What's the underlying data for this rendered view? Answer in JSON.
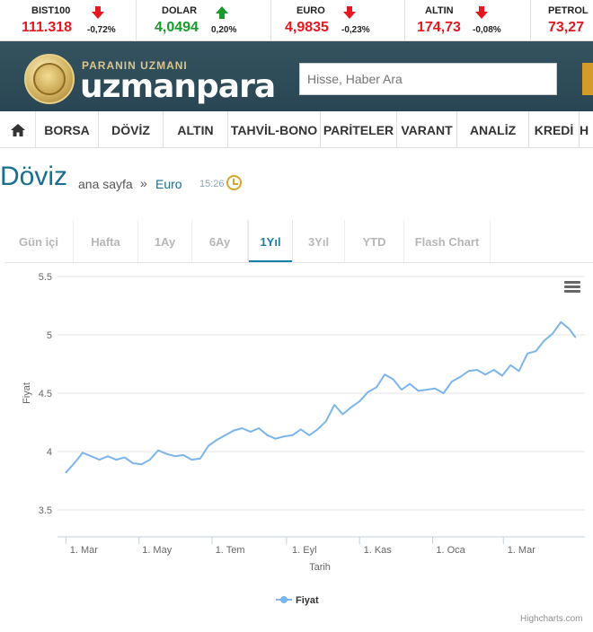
{
  "ticker": [
    {
      "name": "BIST100",
      "value": "111.318",
      "change": "-0,72%",
      "direction": "down"
    },
    {
      "name": "DOLAR",
      "value": "4,0494",
      "change": "0,20%",
      "direction": "up"
    },
    {
      "name": "EURO",
      "value": "4,9835",
      "change": "-0,23%",
      "direction": "down"
    },
    {
      "name": "ALTIN",
      "value": "174,73",
      "change": "-0,08%",
      "direction": "down"
    },
    {
      "name": "PETROL",
      "value": "73,27",
      "change": "",
      "direction": ""
    }
  ],
  "colors": {
    "up": "#1a9a2a",
    "down": "#e4181e",
    "accent": "#1a7fa8",
    "series": "#7cb5ec"
  },
  "header": {
    "tagline": "PARANIN UZMANI",
    "brand": "uzmanpara",
    "search_placeholder": "Hisse, Haber Ara"
  },
  "nav": {
    "home_icon": "home-icon",
    "items": [
      "BORSA",
      "DÖVİZ",
      "ALTIN",
      "TAHVİL-BONO",
      "PARİTELER",
      "VARANT",
      "ANALİZ",
      "KREDİ",
      "H"
    ]
  },
  "breadcrumb": {
    "title": "Döviz",
    "home": "ana sayfa",
    "separator": "»",
    "current": "Euro",
    "time": "15:26"
  },
  "tabs": [
    "Gün içi",
    "Hafta",
    "1Ay",
    "6Ay",
    "1Yıl",
    "3Yıl",
    "YTD",
    "Flash Chart"
  ],
  "active_tab": "1Yıl",
  "chart_data": {
    "type": "line",
    "title": "",
    "xlabel": "Tarih",
    "ylabel": "Fiyat",
    "ylim": [
      3.5,
      5.5
    ],
    "yticks": [
      "3.5",
      "4",
      "4.5",
      "5",
      "5.5"
    ],
    "xticks": [
      "1. Mar",
      "1. May",
      "1. Tem",
      "1. Eyl",
      "1. Kas",
      "1. Oca",
      "1. Mar"
    ],
    "legend": "bottom-center",
    "grid": true,
    "credits": "Highcharts.com",
    "series": [
      {
        "name": "Fiyat",
        "x": [
          "2017-03-01",
          "2017-03-08",
          "2017-03-15",
          "2017-03-22",
          "2017-03-29",
          "2017-04-05",
          "2017-04-12",
          "2017-04-19",
          "2017-04-26",
          "2017-05-03",
          "2017-05-10",
          "2017-05-17",
          "2017-05-24",
          "2017-05-31",
          "2017-06-07",
          "2017-06-14",
          "2017-06-21",
          "2017-06-28",
          "2017-07-05",
          "2017-07-12",
          "2017-07-19",
          "2017-07-26",
          "2017-08-02",
          "2017-08-09",
          "2017-08-16",
          "2017-08-23",
          "2017-08-30",
          "2017-09-06",
          "2017-09-13",
          "2017-09-20",
          "2017-09-27",
          "2017-10-04",
          "2017-10-11",
          "2017-10-18",
          "2017-10-25",
          "2017-11-01",
          "2017-11-08",
          "2017-11-15",
          "2017-11-22",
          "2017-11-29",
          "2017-12-06",
          "2017-12-13",
          "2017-12-20",
          "2017-12-27",
          "2018-01-03",
          "2018-01-10",
          "2018-01-17",
          "2018-01-24",
          "2018-01-31",
          "2018-02-07",
          "2018-02-14",
          "2018-02-21",
          "2018-02-28",
          "2018-03-07",
          "2018-03-14",
          "2018-03-21",
          "2018-03-28",
          "2018-04-04",
          "2018-04-11",
          "2018-04-18",
          "2018-04-25",
          "2018-04-30"
        ],
        "y": [
          3.82,
          3.9,
          3.99,
          3.96,
          3.93,
          3.96,
          3.93,
          3.95,
          3.9,
          3.89,
          3.93,
          4.01,
          3.98,
          3.96,
          3.97,
          3.93,
          3.94,
          4.05,
          4.1,
          4.14,
          4.18,
          4.2,
          4.17,
          4.2,
          4.14,
          4.11,
          4.13,
          4.14,
          4.19,
          4.14,
          4.19,
          4.26,
          4.4,
          4.32,
          4.38,
          4.43,
          4.51,
          4.55,
          4.66,
          4.62,
          4.53,
          4.58,
          4.52,
          4.53,
          4.54,
          4.5,
          4.6,
          4.64,
          4.69,
          4.7,
          4.66,
          4.7,
          4.65,
          4.74,
          4.69,
          4.84,
          4.86,
          4.95,
          5.01,
          5.11,
          5.05,
          4.98
        ]
      }
    ]
  }
}
